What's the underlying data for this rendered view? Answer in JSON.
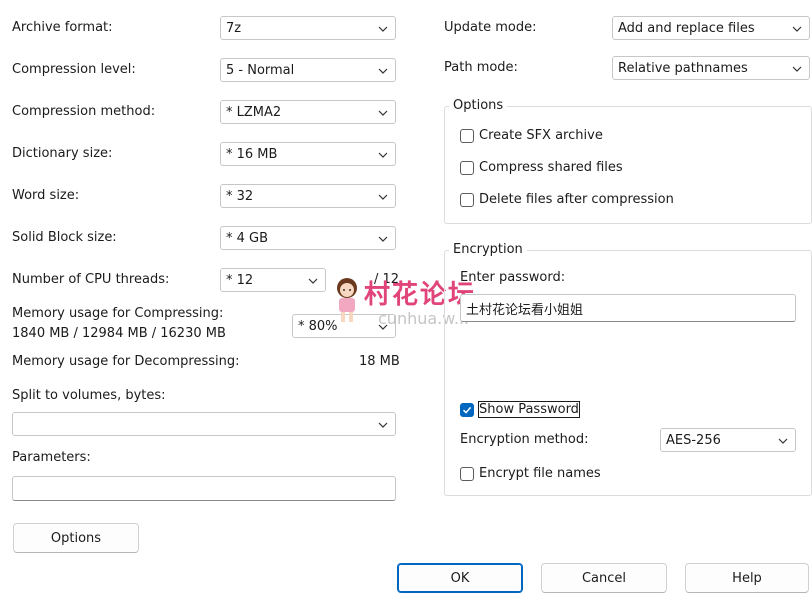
{
  "left": {
    "archive_format": {
      "label": "Archive format:",
      "value": "7z"
    },
    "compression_level": {
      "label": "Compression level:",
      "value": "5 - Normal"
    },
    "compression_method": {
      "label": "Compression method:",
      "value": "*  LZMA2"
    },
    "dictionary_size": {
      "label": "Dictionary size:",
      "value": "*  16 MB"
    },
    "word_size": {
      "label": "Word size:",
      "value": "*  32"
    },
    "solid_block_size": {
      "label": "Solid Block size:",
      "value": "*  4 GB"
    },
    "cpu_threads": {
      "label": "Number of CPU threads:",
      "value": "*  12",
      "total": "/ 12"
    },
    "memory_compress": {
      "label": "Memory usage for Compressing:",
      "detail": "1840 MB / 12984 MB / 16230 MB",
      "value": "* 80%"
    },
    "memory_decompress": {
      "label": "Memory usage for Decompressing:",
      "value": "18 MB"
    },
    "split_volumes": {
      "label": "Split to volumes, bytes:",
      "value": ""
    },
    "parameters": {
      "label": "Parameters:",
      "value": ""
    },
    "options_button": "Options"
  },
  "right": {
    "update_mode": {
      "label": "Update mode:",
      "value": "Add and replace files"
    },
    "path_mode": {
      "label": "Path mode:",
      "value": "Relative pathnames"
    },
    "options_group": {
      "title": "Options",
      "create_sfx": "Create SFX archive",
      "compress_shared": "Compress shared files",
      "delete_after": "Delete files after compression"
    },
    "encryption_group": {
      "title": "Encryption",
      "enter_password_label": "Enter password:",
      "password_value": "土村花论坛看小姐姐",
      "show_password": "Show Password",
      "method_label": "Encryption method:",
      "method_value": "AES-256",
      "encrypt_names": "Encrypt file names"
    }
  },
  "watermark": {
    "text": "村花论坛",
    "sub": "cunhua.w..."
  },
  "buttons": {
    "ok": "OK",
    "cancel": "Cancel",
    "help": "Help"
  },
  "colors": {
    "accent": "#0067c0",
    "watermark": "#e0447a"
  }
}
